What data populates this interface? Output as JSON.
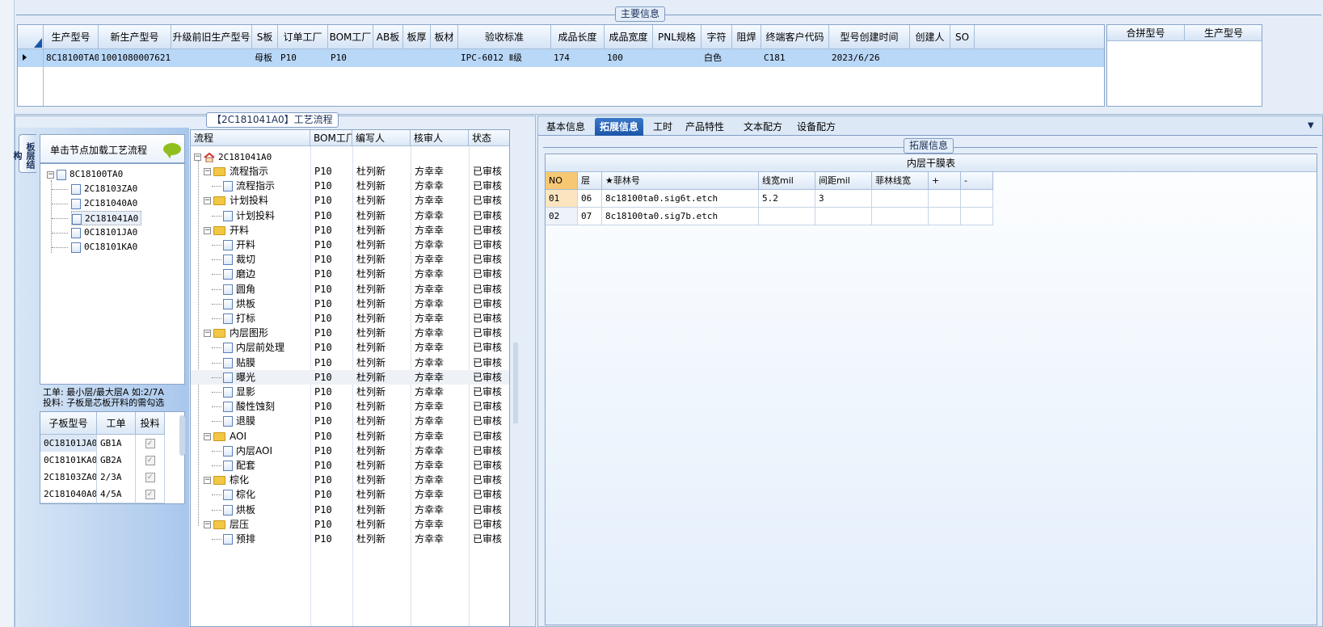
{
  "main_info": {
    "title": "主要信息",
    "columns": [
      "生产型号",
      "新生产型号",
      "升级前旧生产型号",
      "S板",
      "订单工厂",
      "BOM工厂",
      "AB板",
      "板厚",
      "板材",
      "验收标准",
      "成品长度",
      "成品宽度",
      "PNL规格",
      "字符",
      "阻焊",
      "终端客户代码",
      "型号创建时间",
      "创建人",
      "SO"
    ],
    "row": [
      "8C18100TA0",
      "10010800076212",
      "",
      "母板",
      "P10",
      "P10",
      "",
      "",
      "",
      "IPC-6012 Ⅱ级",
      "174",
      "100",
      "",
      "白色",
      "",
      "C181",
      "2023/6/26",
      "",
      ""
    ],
    "merge_columns": [
      "合拼型号",
      "生产型号"
    ]
  },
  "process": {
    "title": "【2C181041A0】工艺流程",
    "vertical_tab": "板层结构",
    "load_hint": "单击节点加载工艺流程",
    "structure_tree": {
      "root": "8C18100TA0",
      "children": [
        "2C18103ZA0",
        "2C181040A0",
        "2C181041A0",
        "0C18101JA0",
        "0C18101KA0"
      ]
    },
    "note_line1": "工单: 最小层/最大层A 如:2/7A",
    "note_line2": "投料: 子板是芯板开料的需勾选",
    "sub_columns": [
      "子板型号",
      "工单",
      "投料"
    ],
    "sub_rows": [
      {
        "model": "0C18101JA0",
        "order": "GB1A",
        "check": "✓"
      },
      {
        "model": "0C18101KA0",
        "order": "GB2A",
        "check": "✓"
      },
      {
        "model": "2C18103ZA0",
        "order": "2/3A",
        "check": "✓"
      },
      {
        "model": "2C181040A0",
        "order": "4/5A",
        "check": "✓"
      }
    ],
    "flow_columns": [
      "流程",
      "BOM工厂",
      "编写人",
      "核审人",
      "状态"
    ],
    "flow_root": "2C181041A0",
    "flow_rows": [
      {
        "name": "流程指示",
        "level": 1,
        "bom": "P10",
        "writer": "杜列新",
        "reviewer": "方幸幸",
        "status": "已审核"
      },
      {
        "name": "流程指示",
        "level": 2,
        "bom": "P10",
        "writer": "杜列新",
        "reviewer": "方幸幸",
        "status": "已审核"
      },
      {
        "name": "计划投料",
        "level": 1,
        "bom": "P10",
        "writer": "杜列新",
        "reviewer": "方幸幸",
        "status": "已审核"
      },
      {
        "name": "计划投料",
        "level": 2,
        "bom": "P10",
        "writer": "杜列新",
        "reviewer": "方幸幸",
        "status": "已审核"
      },
      {
        "name": "开料",
        "level": 1,
        "bom": "P10",
        "writer": "杜列新",
        "reviewer": "方幸幸",
        "status": "已审核"
      },
      {
        "name": "开料",
        "level": 2,
        "bom": "P10",
        "writer": "杜列新",
        "reviewer": "方幸幸",
        "status": "已审核"
      },
      {
        "name": "裁切",
        "level": 2,
        "bom": "P10",
        "writer": "杜列新",
        "reviewer": "方幸幸",
        "status": "已审核"
      },
      {
        "name": "磨边",
        "level": 2,
        "bom": "P10",
        "writer": "杜列新",
        "reviewer": "方幸幸",
        "status": "已审核"
      },
      {
        "name": "圆角",
        "level": 2,
        "bom": "P10",
        "writer": "杜列新",
        "reviewer": "方幸幸",
        "status": "已审核"
      },
      {
        "name": "烘板",
        "level": 2,
        "bom": "P10",
        "writer": "杜列新",
        "reviewer": "方幸幸",
        "status": "已审核"
      },
      {
        "name": "打标",
        "level": 2,
        "bom": "P10",
        "writer": "杜列新",
        "reviewer": "方幸幸",
        "status": "已审核"
      },
      {
        "name": "内层图形",
        "level": 1,
        "bom": "P10",
        "writer": "杜列新",
        "reviewer": "方幸幸",
        "status": "已审核"
      },
      {
        "name": "内层前处理",
        "level": 2,
        "bom": "P10",
        "writer": "杜列新",
        "reviewer": "方幸幸",
        "status": "已审核"
      },
      {
        "name": "贴膜",
        "level": 2,
        "bom": "P10",
        "writer": "杜列新",
        "reviewer": "方幸幸",
        "status": "已审核"
      },
      {
        "name": "曝光",
        "level": 2,
        "bom": "P10",
        "writer": "杜列新",
        "reviewer": "方幸幸",
        "status": "已审核"
      },
      {
        "name": "显影",
        "level": 2,
        "bom": "P10",
        "writer": "杜列新",
        "reviewer": "方幸幸",
        "status": "已审核"
      },
      {
        "name": "酸性蚀刻",
        "level": 2,
        "bom": "P10",
        "writer": "杜列新",
        "reviewer": "方幸幸",
        "status": "已审核"
      },
      {
        "name": "退膜",
        "level": 2,
        "bom": "P10",
        "writer": "杜列新",
        "reviewer": "方幸幸",
        "status": "已审核"
      },
      {
        "name": "AOI",
        "level": 1,
        "bom": "P10",
        "writer": "杜列新",
        "reviewer": "方幸幸",
        "status": "已审核"
      },
      {
        "name": "内层AOI",
        "level": 2,
        "bom": "P10",
        "writer": "杜列新",
        "reviewer": "方幸幸",
        "status": "已审核"
      },
      {
        "name": "配套",
        "level": 2,
        "bom": "P10",
        "writer": "杜列新",
        "reviewer": "方幸幸",
        "status": "已审核"
      },
      {
        "name": "棕化",
        "level": 1,
        "bom": "P10",
        "writer": "杜列新",
        "reviewer": "方幸幸",
        "status": "已审核"
      },
      {
        "name": "棕化",
        "level": 2,
        "bom": "P10",
        "writer": "杜列新",
        "reviewer": "方幸幸",
        "status": "已审核"
      },
      {
        "name": "烘板",
        "level": 2,
        "bom": "P10",
        "writer": "杜列新",
        "reviewer": "方幸幸",
        "status": "已审核"
      },
      {
        "name": "层压",
        "level": 1,
        "bom": "P10",
        "writer": "杜列新",
        "reviewer": "方幸幸",
        "status": "已审核"
      },
      {
        "name": "预排",
        "level": 2,
        "bom": "P10",
        "writer": "杜列新",
        "reviewer": "方幸幸",
        "status": "已审核"
      }
    ]
  },
  "right": {
    "tabs": [
      "基本信息",
      "拓展信息",
      "工时",
      "产品特性",
      "文本配方",
      "设备配方"
    ],
    "active_tab": "拓展信息",
    "section_title": "拓展信息",
    "table_title": "内层干膜表",
    "columns": [
      "NO",
      "层",
      "★菲林号",
      "线宽mil",
      "间距mil",
      "菲林线宽",
      "+",
      "-"
    ],
    "rows": [
      [
        "01",
        "06",
        "8c18100ta0.sig6t.etch",
        "5.2",
        "3",
        "",
        "",
        ""
      ],
      [
        "02",
        "07",
        "8c18100ta0.sig7b.etch",
        "",
        "",
        "",
        "",
        ""
      ]
    ]
  },
  "colors": {
    "selected_row": "#b9d7f7",
    "active_tab": "#1c56a8",
    "panel": "#e4edf8",
    "accent_cell": "#f7c873"
  }
}
